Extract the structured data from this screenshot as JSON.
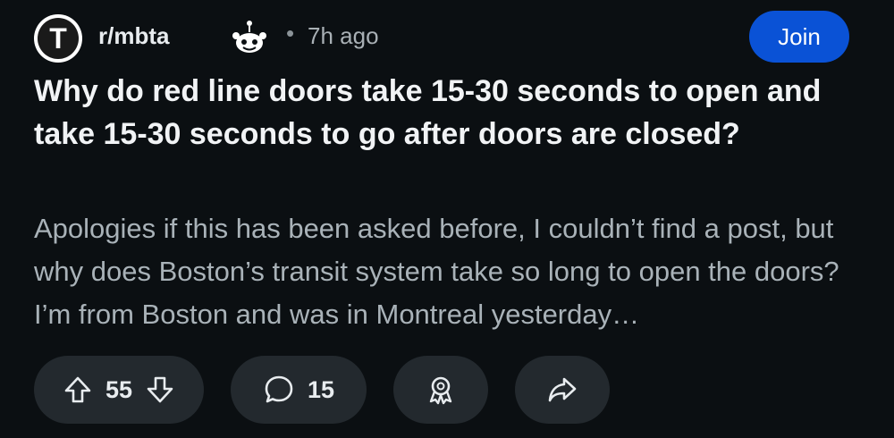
{
  "header": {
    "community_avatar_letter": "T",
    "subreddit": "r/mbta",
    "separator": "•",
    "time_ago": "7h ago",
    "join_label": "Join"
  },
  "post": {
    "title": "Why do red line doors take 15-30 seconds to open and take 15-30 seconds to go after doors are closed?",
    "body": "Apologies if this has been asked before, I couldn’t find a post, but why does Boston’s transit system take so long to open the doors? I’m from Boston and was in Montreal yesterday…"
  },
  "actions": {
    "score": "55",
    "comments": "15",
    "icons": [
      "upvote-icon",
      "downvote-icon",
      "comment-icon",
      "award-icon",
      "share-icon"
    ]
  },
  "colors": {
    "background": "#0b0f12",
    "join_button": "#0a52d6",
    "pill": "#23292e",
    "body_text": "#a9b2b8"
  }
}
